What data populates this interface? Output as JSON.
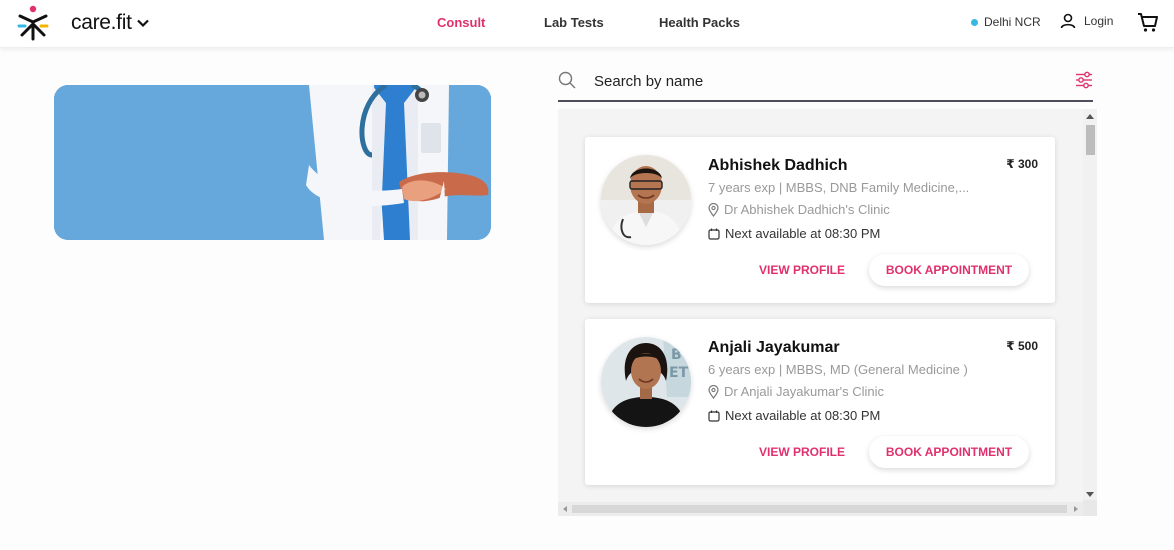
{
  "header": {
    "brand": "care.fit",
    "nav": [
      {
        "label": "Consult",
        "active": true
      },
      {
        "label": "Lab Tests",
        "active": false
      },
      {
        "label": "Health Packs",
        "active": false
      }
    ],
    "location": "Delhi NCR",
    "login_label": "Login"
  },
  "search": {
    "placeholder": "Search by name"
  },
  "doctors": [
    {
      "name": "Abhishek Dadhich",
      "price": "₹ 300",
      "experience": "7 years exp | MBBS, DNB Family Medicine,...",
      "clinic": "Dr Abhishek Dadhich's Clinic",
      "availability": "Next available at 08:30 PM",
      "view_profile_label": "VIEW PROFILE",
      "book_label": "BOOK APPOINTMENT"
    },
    {
      "name": "Anjali Jayakumar",
      "price": "₹ 500",
      "experience": "6 years exp | MBBS, MD (General Medicine )",
      "clinic": "Dr Anjali Jayakumar's Clinic",
      "availability": "Next available at 08:30 PM",
      "view_profile_label": "VIEW PROFILE",
      "book_label": "BOOK APPOINTMENT"
    }
  ],
  "colors": {
    "accent": "#e0306d",
    "banner_bg": "#66a8dc",
    "location_dot": "#35b8e3"
  }
}
